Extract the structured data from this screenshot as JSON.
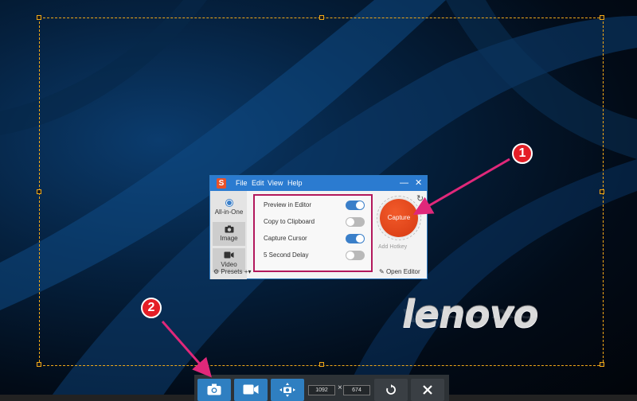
{
  "wallpaper": {
    "brand_text": "lenovo"
  },
  "widget": {
    "menu": [
      "File",
      "Edit",
      "View",
      "Help"
    ],
    "modes": [
      {
        "label": "All-in-One",
        "icon": "radio-dot-icon"
      },
      {
        "label": "Image",
        "icon": "camera-icon"
      },
      {
        "label": "Video",
        "icon": "video-camera-icon"
      }
    ],
    "options": [
      {
        "label": "Preview in Editor",
        "state": "on"
      },
      {
        "label": "Copy to Clipboard",
        "state": "off"
      },
      {
        "label": "Capture Cursor",
        "state": "on"
      },
      {
        "label": "5 Second Delay",
        "state": "off"
      }
    ],
    "capture_label": "Capture",
    "hotkey_label": "Add Hotkey",
    "presets_label": "Presets",
    "open_editor_label": "Open Editor",
    "window_controls": {
      "minimize": "—",
      "close": "✕"
    }
  },
  "toolbar": {
    "width_value": "1092",
    "times": "×",
    "height_value": "674"
  },
  "annotations": {
    "badge_1": "1",
    "badge_2": "2"
  },
  "colors": {
    "accent_blue": "#2b7bd0",
    "capture_red": "#e8401a",
    "highlight_border": "#b2185c",
    "selection_dash": "#f0a818",
    "annotation_red": "#e41e26"
  }
}
